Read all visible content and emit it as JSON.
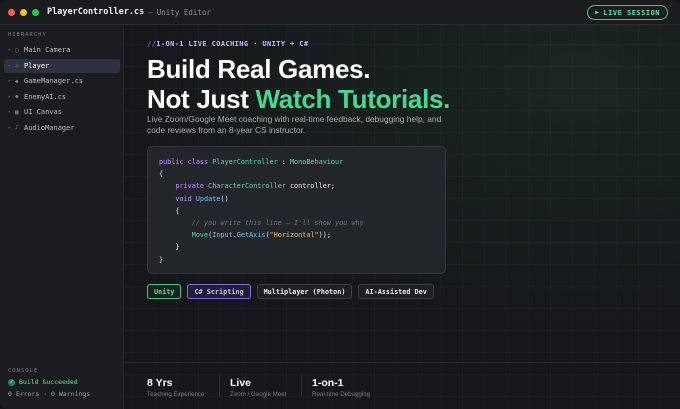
{
  "window": {
    "file_name": "PlayerController.cs",
    "separator": "—",
    "app_name": "Unity Editor",
    "live_label": "LIVE SESSION",
    "dot_colors": [
      "#ff5f57",
      "#febc2e",
      "#28c840"
    ]
  },
  "sidebar": {
    "hierarchy_label": "HIERARCHY",
    "items": [
      {
        "icon": "▢",
        "label": "Main Camera",
        "selected": false
      },
      {
        "icon": "♙",
        "label": "Player",
        "selected": true
      },
      {
        "icon": "◆",
        "label": "GameManager.cs",
        "selected": false
      },
      {
        "icon": "◆",
        "label": "EnemyAI.cs",
        "selected": false
      },
      {
        "icon": "▦",
        "label": "UI Canvas",
        "selected": false
      },
      {
        "icon": "♪",
        "label": "AudioManager",
        "selected": false
      }
    ],
    "console_label": "CONSOLE",
    "console_status": "Build Succeeded",
    "console_counts": "0 Errors · 0 Warnings"
  },
  "hero": {
    "eyebrow_prefix": "//",
    "eyebrow": "1-ON-1 LIVE COACHING · UNITY + C#",
    "headline_line1": "Build Real Games.",
    "headline_line2_prefix": "Not Just ",
    "headline_line2_accent": "Watch Tutorials.",
    "lead": "Live Zoom/Google Meet coaching with real-time feedback, debugging help, and code reviews from an 8-year CS instructor."
  },
  "code": {
    "l1_kw": "public class ",
    "l1_type": "PlayerController",
    "l1_sep": " : ",
    "l1_base": "MonoBehaviour",
    "l2": "{",
    "l3_kw": "private ",
    "l3_type": "CharacterController",
    "l3_name": " controller;",
    "l4_kw": "void ",
    "l4_fn": "Update",
    "l4_rest": "()",
    "l5": "{",
    "l6": "// you write this line — I'll show you why",
    "l7_fn": "Move",
    "l7_a": "(",
    "l7_type": "Input",
    "l7_b": ".",
    "l7_fn2": "GetAxis",
    "l7_c": "(",
    "l7_str": "\"Horizontal\"",
    "l7_d": "));",
    "l8": "}",
    "l9": "}"
  },
  "tags": [
    "Unity",
    "C# Scripting",
    "Multiplayer (Photon)",
    "AI-Assisted Dev"
  ],
  "stats": [
    {
      "value": "8 Yrs",
      "label": "Teaching Experience"
    },
    {
      "value": "Live",
      "label": "Zoom / Google Meet"
    },
    {
      "value": "1-on-1",
      "label": "Real-time Debugging"
    }
  ]
}
